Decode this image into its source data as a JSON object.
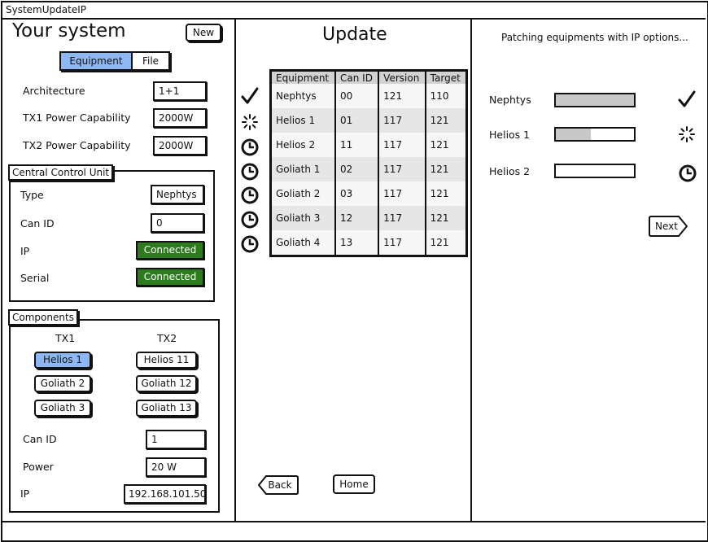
{
  "window": {
    "title": "SystemUpdateIP"
  },
  "left": {
    "title": "Your system",
    "new_label": "New",
    "tabs": [
      "Equipment",
      "File"
    ],
    "active_tab": "Equipment",
    "fields": [
      {
        "label": "Architecture",
        "value": "1+1"
      },
      {
        "label": "TX1 Power Capability",
        "value": "2000W"
      },
      {
        "label": "TX2 Power Capability",
        "value": "2000W"
      }
    ],
    "ccu": {
      "title": "Central Control Unit",
      "type_label": "Type",
      "type_value": "Nephtys",
      "canid_label": "Can ID",
      "canid_value": "0",
      "ip_label": "IP",
      "ip_value": "Connected",
      "serial_label": "Serial",
      "serial_value": "Connected"
    },
    "components": {
      "title": "Components",
      "tx1_label": "TX1",
      "tx2_label": "TX2",
      "tx1": [
        "Helios 1",
        "Goliath 2",
        "Goliath 3"
      ],
      "tx2": [
        "Helios 11",
        "Goliath 12",
        "Goliath 13"
      ],
      "selected": "Helios 1",
      "canid_label": "Can ID",
      "canid_value": "1",
      "power_label": "Power",
      "power_value": "20 W",
      "ip_label": "IP",
      "ip_value": "192.168.101.50"
    }
  },
  "middle": {
    "title": "Update",
    "columns": [
      "Equipment",
      "Can ID",
      "Version",
      "Target"
    ],
    "rows": [
      [
        "Nephtys",
        "00",
        "121",
        "110"
      ],
      [
        "Helios 1",
        "01",
        "117",
        "121"
      ],
      [
        "Helios 2",
        "11",
        "117",
        "121"
      ],
      [
        "Goliath 1",
        "02",
        "117",
        "121"
      ],
      [
        "Goliath 2",
        "03",
        "117",
        "121"
      ],
      [
        "Goliath 3",
        "12",
        "117",
        "121"
      ],
      [
        "Goliath 4",
        "13",
        "117",
        "121"
      ]
    ],
    "row_status_icons": [
      "check-icon",
      "loading-spinner-icon",
      "clock-icon",
      "clock-icon",
      "clock-icon",
      "clock-icon",
      "clock-icon"
    ],
    "back_label": "Back",
    "home_label": "Home"
  },
  "right": {
    "status_text": "Patching equipments with IP options...",
    "items": [
      {
        "name": "Nephtys",
        "progress": 1.0,
        "status_icon": "check-icon"
      },
      {
        "name": "Helios 1",
        "progress": 0.45,
        "status_icon": "loading-spinner-icon"
      },
      {
        "name": "Helios 2",
        "progress": 0.0,
        "status_icon": "clock-icon"
      }
    ],
    "next_label": "Next"
  }
}
